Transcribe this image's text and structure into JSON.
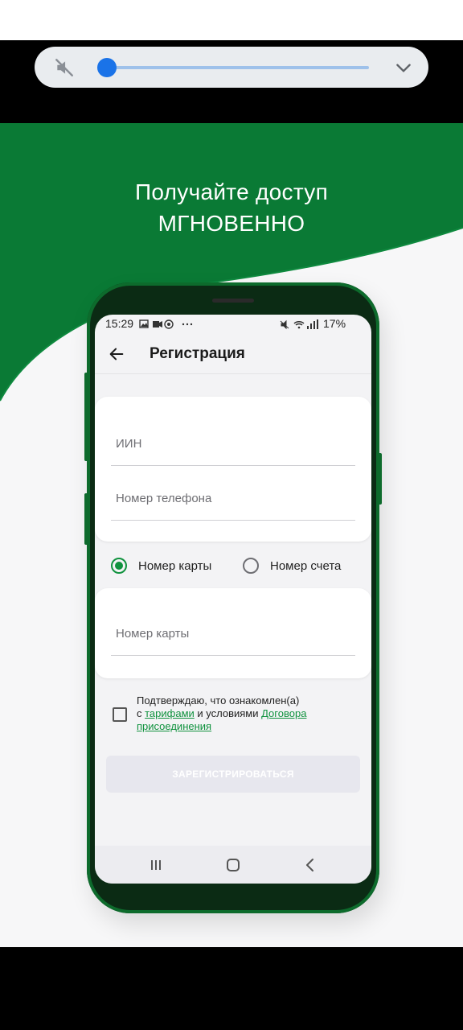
{
  "colors": {
    "brand_green": "#0a7a35",
    "accent_blue": "#1a73e8"
  },
  "volume": {
    "level": 0.03,
    "mute_icon": "volume-mute-icon",
    "expand_icon": "chevron-down-icon"
  },
  "promo": {
    "line1": "Получайте доступ",
    "line2": "МГНОВЕННО"
  },
  "status_bar": {
    "time": "15:29",
    "battery": "17%"
  },
  "app_bar": {
    "title": "Регистрация",
    "back_icon": "arrow-back-icon"
  },
  "form": {
    "iin_placeholder": "ИИН",
    "phone_placeholder": "Номер телефона",
    "card_placeholder": "Номер карты"
  },
  "radio": {
    "options": [
      {
        "label": "Номер карты",
        "selected": true
      },
      {
        "label": "Номер счета",
        "selected": false
      }
    ]
  },
  "consent": {
    "text_a": "Подтверждаю, что ознакомлен(а)",
    "text_b": "с ",
    "link1": "тарифами",
    "text_c": " и условиями ",
    "link2": "Договора присоединения",
    "checked": false
  },
  "register_button": {
    "label": "ЗАРЕГИСТРИРОВАТЬСЯ",
    "enabled": false
  },
  "nav": {
    "recent_icon": "recent-apps-icon",
    "home_icon": "home-icon",
    "back_icon": "nav-back-icon"
  }
}
